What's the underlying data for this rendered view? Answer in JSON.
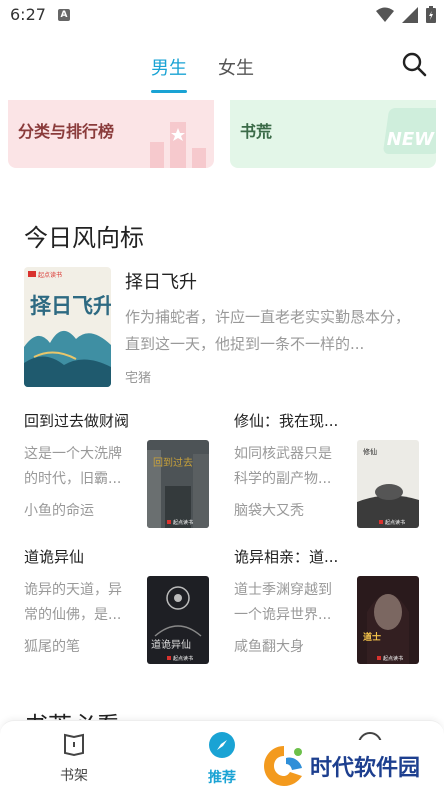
{
  "status_bar": {
    "time": "6:27",
    "notif_letter": "A"
  },
  "top_nav": {
    "tabs": [
      "男生",
      "女生"
    ],
    "active_tab": "男生"
  },
  "quick_cards": {
    "rank_label": "分类与排行榜",
    "shortage_label": "书荒",
    "new_badge": "NEW"
  },
  "section": {
    "title": "今日风向标",
    "next_title": "书荒必看"
  },
  "featured": {
    "title": "择日飞升",
    "desc": "作为捕蛇者，许应一直老老实实勤恳本分，直到这一天，他捉到一条不一样的...",
    "author": "宅猪",
    "cover_publisher": "起点读书",
    "cover_title": "择日飞升"
  },
  "books": [
    {
      "title": "回到过去做财阀",
      "desc": "这是一个大洗牌的时代，旧霸...",
      "author": "小鱼的命运",
      "cover_publisher": "起点读书"
    },
    {
      "title": "修仙：我在现...",
      "desc": "如同核武器只是科学的副产物...",
      "author": "脑袋大又秃",
      "cover_publisher": "起点读书"
    },
    {
      "title": "道诡异仙",
      "desc": "诡异的天道，异常的仙佛，是...",
      "author": "狐尾的笔",
      "cover_publisher": "起点读书"
    },
    {
      "title": "诡异相亲：道...",
      "desc": "道士季渊穿越到一个诡异世界...",
      "author": "咸鱼翻大身",
      "cover_publisher": "起点读书"
    }
  ],
  "bottom_nav": {
    "shelf": "书架",
    "recommend": "推荐"
  },
  "watermark": {
    "text": "时代软件园"
  },
  "colors": {
    "accent": "#1aa3d4",
    "rank_bg": "#fbe4e6",
    "shortage_bg": "#e3f6e8"
  }
}
